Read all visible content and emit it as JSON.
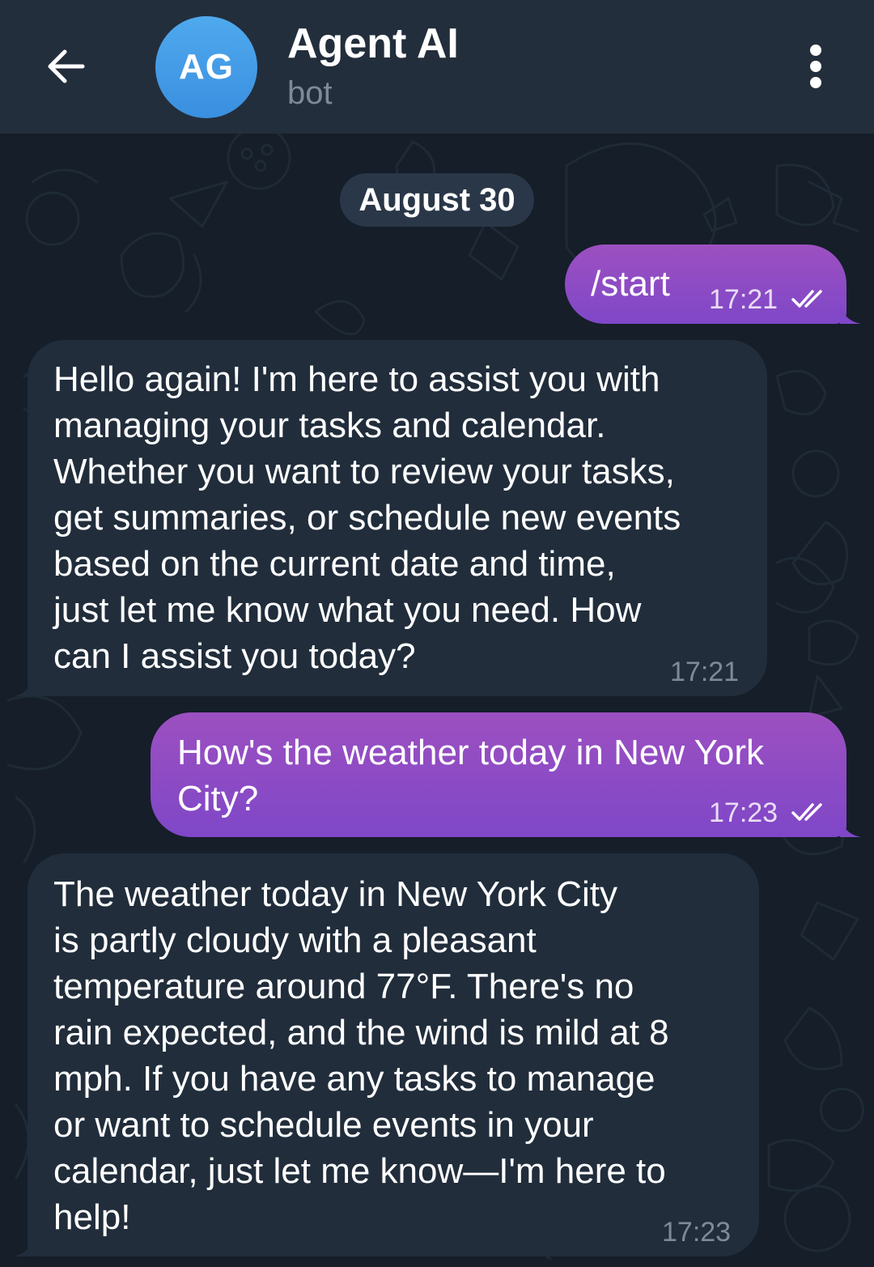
{
  "header": {
    "avatar_initials": "AG",
    "title": "Agent AI",
    "subtitle": "bot",
    "back_icon": "arrow-left-icon",
    "menu_icon": "more-vertical-icon"
  },
  "chat": {
    "date_label": "August 30",
    "messages": [
      {
        "direction": "outgoing",
        "text": "/start",
        "time": "17:21",
        "status": "read"
      },
      {
        "direction": "incoming",
        "text": "Hello again! I'm here to assist you with\nmanaging your tasks and calendar.\nWhether you want to review your tasks,\nget summaries, or schedule new events\nbased on the current date and time,\njust let me know what you need. How\ncan I assist you today?",
        "time": "17:21"
      },
      {
        "direction": "outgoing",
        "text": "How's the weather today in New York\nCity?",
        "time": "17:23",
        "status": "read"
      },
      {
        "direction": "incoming",
        "text": "The weather today in New York City\nis partly cloudy with a pleasant\ntemperature around 77°F. There's no\nrain expected, and the wind is mild at 8\nmph. If you have any tasks to manage\nor want to schedule events in your\ncalendar, just let me know—I'm here to\nhelp!",
        "time": "17:23"
      }
    ]
  },
  "colors": {
    "header_bg": "#232e3c",
    "chat_bg": "#151e29",
    "outgoing_bubble": "#8a4ec2",
    "incoming_bubble": "#212d3b",
    "avatar": "#419fe8",
    "subtitle": "#7c8a99"
  }
}
